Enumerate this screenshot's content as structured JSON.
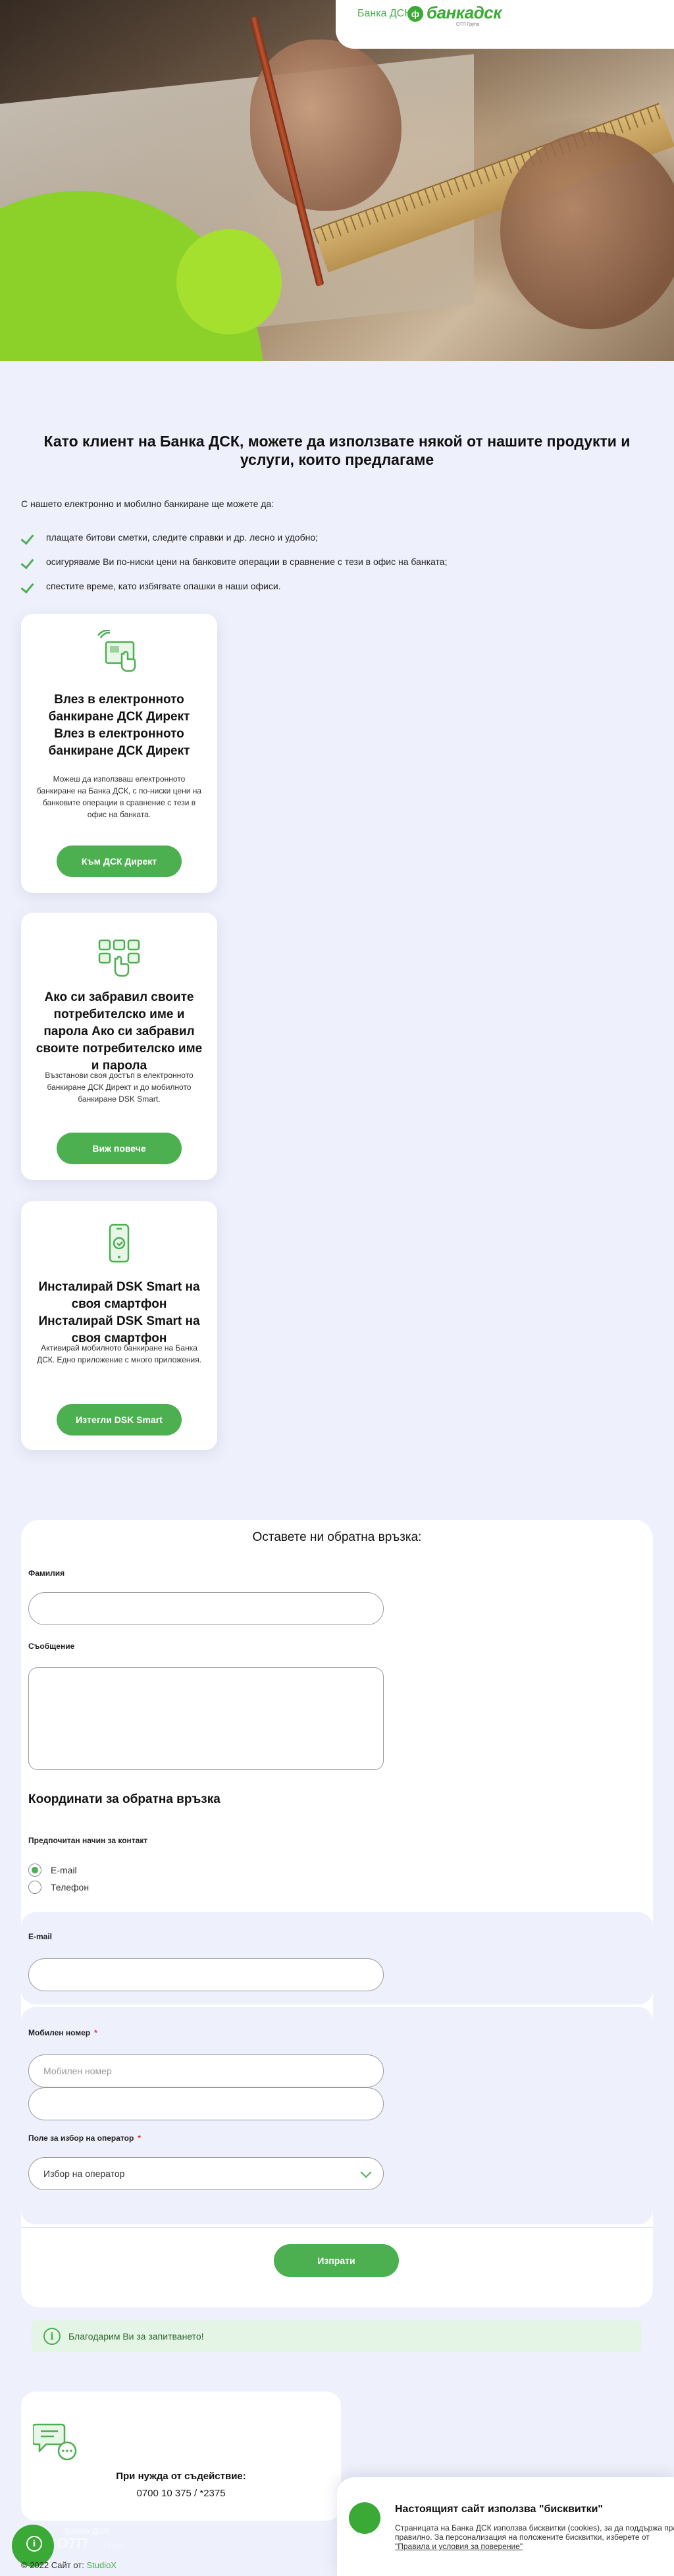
{
  "brand": {
    "dsk_label": "Банка ДСК",
    "mark": "ф",
    "banka_logo": "банкадск",
    "logo_sub": "ОТП Група"
  },
  "intro": {
    "title": "Като клиент на Банка ДСК, можете да използвате някой от нашите продукти и услуги, които предлагаме",
    "lead": "С нашето електронно и мобилно банкиране ще можете да:",
    "bullets": [
      "плащате битови сметки, следите справки и др. лесно и удобно;",
      "осигуряваме Ви по-ниски цени на банковите операции в сравнение с тези в офис на банката;",
      "спестите време, като избягвате опашки в наши офиси."
    ]
  },
  "cards": [
    {
      "title": "Влез в електронното банкиране ДСК Директ Влез в електронното банкиране ДСК Директ",
      "desc": "Можеш да използваш електронното банкиране на Банка ДСК, с по-ниски цени на банковите операции в сравнение с тези в офис на банката.",
      "button": "Към ДСК Директ"
    },
    {
      "title": "Ако си забравил своите потребителско име и парола Ако си забравил своите потребителско име и парола",
      "desc": "Възстанови своя достъп в електронното банкиране ДСК Директ и до мобилното банкиране DSK Smart.",
      "button": "Виж повече"
    },
    {
      "title": "Инсталирай DSK Smart на своя смартфон Инсталирай DSK Smart на своя смартфон",
      "desc": "Активирай мобилното банкиране на Банка ДСК. Едно приложение с много приложения.",
      "button": "Изтегли DSK Smart"
    }
  ],
  "form": {
    "title": "Оставете ни обратна връзка:",
    "surname_label": "Фамилия",
    "surname_value": "",
    "message_label": "Съобщение",
    "contacts_heading": "Координати за обратна връзка",
    "preferred_label": "Предпочитан начин за контакт",
    "radio_options": [
      "E-mail",
      "Телефон"
    ],
    "email_label": "E-mail",
    "mobile_label": "Мобилен номер",
    "mobile_placeholder": "Мобилен номер",
    "operator_label": "Поле за избор на оператор",
    "operator_selected": "Избор на оператор",
    "submit": "Изпрати"
  },
  "success": {
    "icon": "i",
    "text": "Благодарим Ви за запитването!"
  },
  "help": {
    "title": "При нужда от съдействие:",
    "phone": "0700 10 375 / *2375"
  },
  "footer": {
    "copy": "© 2022 Сайт от: ",
    "studio": "StudioX",
    "ghost_brand": "Банка ДСК",
    "ghost_logo": "ОТП",
    "ghost_sub": "Група"
  },
  "cookie": {
    "title": "Настоящият сайт използва \"бисквитки\"",
    "line1": "Страницата на Банка ДСК използва бисквитки (cookies), за да поддържа правилно",
    "line2": "правилно. За персонализация на положените бисквитки, изберете от",
    "link": "\"Правила и условия за поверение\""
  },
  "colors": {
    "accent": "#4caf50",
    "brand_green": "#3aa935",
    "page_bg": "#eef0fb",
    "success_bg": "#e4f4e5"
  }
}
